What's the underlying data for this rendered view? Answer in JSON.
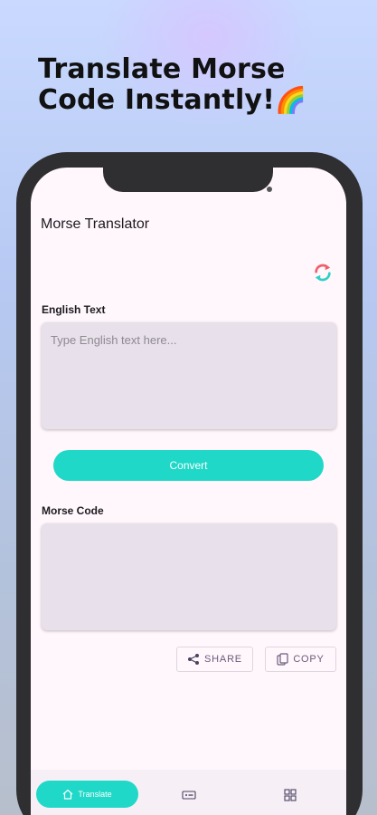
{
  "promo": {
    "headline": "Translate Morse Code Instantly!",
    "emoji": "🌈"
  },
  "app": {
    "title": "Morse Translator"
  },
  "english": {
    "label": "English Text",
    "placeholder": "Type English text here...",
    "value": ""
  },
  "convert_label": "Convert",
  "morse": {
    "label": "Morse Code",
    "value": ""
  },
  "actions": {
    "share_label": "SHARE",
    "copy_label": "COPY"
  },
  "nav": {
    "items": [
      {
        "label": "Translate",
        "icon": "home-icon",
        "active": true
      },
      {
        "label": "",
        "icon": "morse-icon",
        "active": false
      },
      {
        "label": "",
        "icon": "grid-icon",
        "active": false
      }
    ]
  },
  "colors": {
    "accent": "#1fd8c8",
    "field_bg": "#e8e0ea",
    "screen_bg": "#fff7fc"
  }
}
